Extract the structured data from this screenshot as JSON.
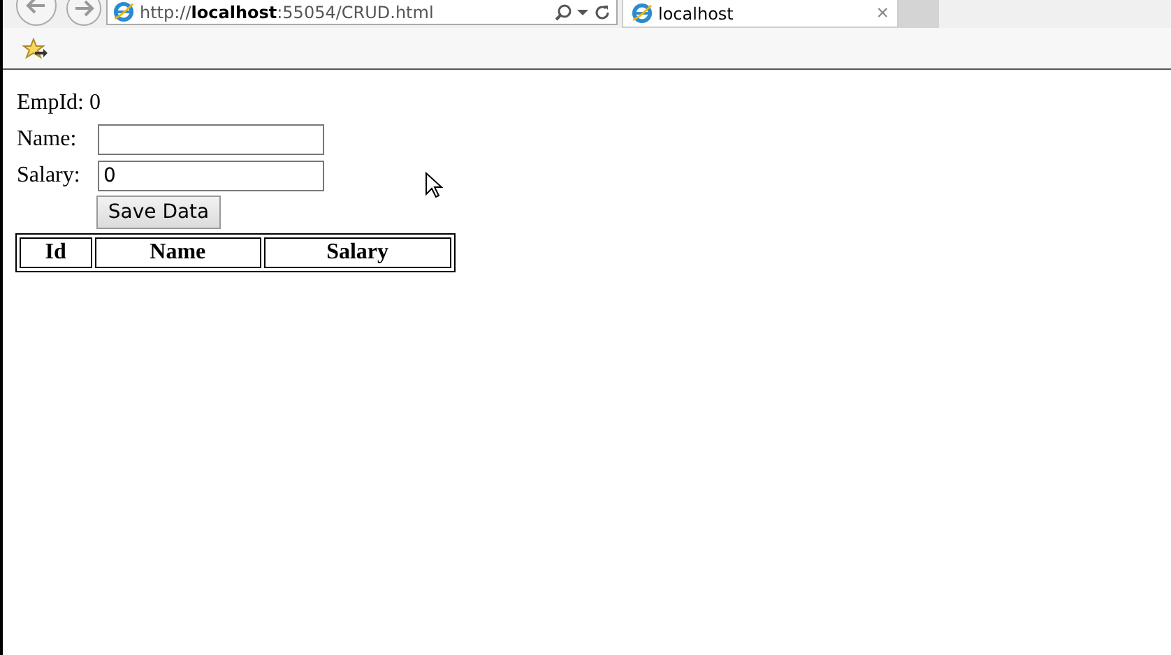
{
  "browser": {
    "address": "http://**localhost**:55054/CRUD.html",
    "tab": {
      "label": "localhost",
      "close": "×",
      "selected": true
    }
  },
  "form": {
    "empid_label": "EmpId:",
    "empid_value": "0",
    "fields": [
      {
        "label": "Name:"
      },
      {
        "label": "Salary:",
        "value": "0"
      }
    ],
    "button": "Save Data"
  },
  "table": {
    "columns": [
      "Id",
      "Name",
      "Salary"
    ]
  }
}
